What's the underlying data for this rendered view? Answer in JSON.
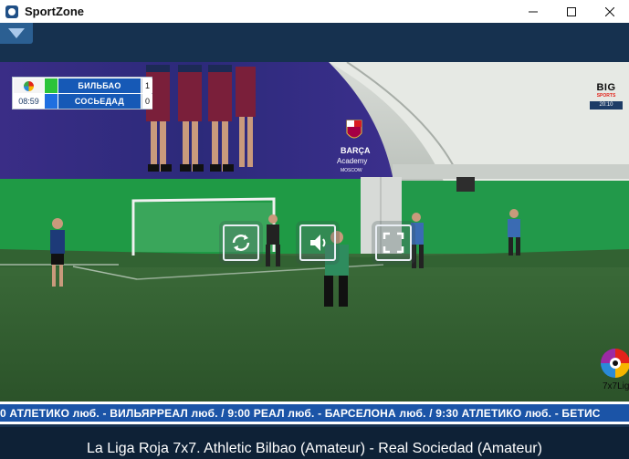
{
  "window": {
    "title": "SportZone",
    "controls": {
      "minimize": "—",
      "maximize": "☐",
      "close": "✕"
    }
  },
  "toolbar": {
    "menu_icon": "chevron-down-icon"
  },
  "scoreboard": {
    "time": "08:59",
    "team_home": {
      "name": "БИЛЬБАО",
      "score": "1",
      "color": "#2bc43a"
    },
    "team_away": {
      "name": "СОСЬЕДАД",
      "score": "0",
      "color": "#1f6fe0"
    }
  },
  "banner": {
    "text1": "BARÇA",
    "text2": "Academy",
    "text3": "MOSCOW"
  },
  "broadcaster": {
    "name": "BIG",
    "sub": "SPORTS",
    "time": "20:10"
  },
  "player_controls": [
    {
      "name": "replay-button",
      "icon": "replay-icon"
    },
    {
      "name": "volume-button",
      "icon": "speaker-icon"
    },
    {
      "name": "fullscreen-button",
      "icon": "fullscreen-icon"
    }
  ],
  "watermark": {
    "text": "7x7Lig"
  },
  "ticker": {
    "text": "0 АТЛЕТИКО люб. - ВИЛЬЯРРЕАЛ люб. / 9:00 РЕАЛ люб. - БАРСЕЛОНА люб. / 9:30 АТЛЕТИКО люб. - БЕТИС"
  },
  "footer": {
    "title": "La Liga Roja 7x7. Athletic Bilbao (Amateur) - Real Sociedad (Amateur)"
  }
}
